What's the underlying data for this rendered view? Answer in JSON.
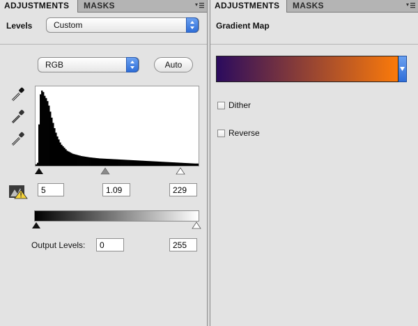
{
  "left": {
    "tabs": [
      "ADJUSTMENTS",
      "MASKS"
    ],
    "preset_label": "Levels",
    "preset_value": "Custom",
    "channel_value": "RGB",
    "auto_label": "Auto",
    "input_black": "5",
    "input_gamma": "1.09",
    "input_white": "229",
    "output_label": "Output Levels:",
    "output_black": "0",
    "output_white": "255"
  },
  "right": {
    "tabs": [
      "ADJUSTMENTS",
      "MASKS"
    ],
    "title": "Gradient Map",
    "gradient_colors": [
      "#2b0b5e",
      "#fb7a0a"
    ],
    "dither_label": "Dither",
    "reverse_label": "Reverse",
    "dither_checked": false,
    "reverse_checked": false
  },
  "icons": {
    "eyedroppers": [
      "black-point-eyedropper-icon",
      "gray-point-eyedropper-icon",
      "white-point-eyedropper-icon"
    ],
    "clipping_warning": "clipping-warning-icon",
    "panel_menu": "panel-menu-icon"
  },
  "histogram": {
    "levels": [
      0.02,
      0.04,
      0.55,
      0.95,
      1.0,
      0.98,
      0.93,
      0.9,
      0.86,
      0.8,
      0.72,
      0.64,
      0.57,
      0.5,
      0.44,
      0.39,
      0.35,
      0.31,
      0.28,
      0.26,
      0.24,
      0.22,
      0.2,
      0.19,
      0.18,
      0.17,
      0.16,
      0.155,
      0.15,
      0.145,
      0.14,
      0.135,
      0.13,
      0.127,
      0.124,
      0.121,
      0.118,
      0.115,
      0.112,
      0.11,
      0.108,
      0.106,
      0.104,
      0.102,
      0.1,
      0.098,
      0.097,
      0.096,
      0.095,
      0.094,
      0.093,
      0.092,
      0.091,
      0.09,
      0.089,
      0.088,
      0.087,
      0.086,
      0.085,
      0.084,
      0.083,
      0.082,
      0.081,
      0.08,
      0.079,
      0.078,
      0.077,
      0.076,
      0.075,
      0.074,
      0.073,
      0.072,
      0.071,
      0.07,
      0.069,
      0.068,
      0.067,
      0.066,
      0.065,
      0.064,
      0.063,
      0.062,
      0.061,
      0.06,
      0.059,
      0.058,
      0.057,
      0.056,
      0.055,
      0.054,
      0.053,
      0.052,
      0.051,
      0.05,
      0.049,
      0.048,
      0.047,
      0.046,
      0.045,
      0.044,
      0.043,
      0.042,
      0.041,
      0.04,
      0.039,
      0.038,
      0.037,
      0.036,
      0.035,
      0.034,
      0.033,
      0.032,
      0.031,
      0.03,
      0.03,
      0.03
    ]
  }
}
